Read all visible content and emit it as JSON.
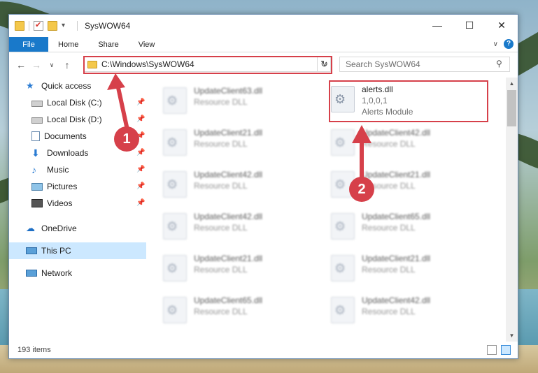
{
  "window": {
    "title": "SysWOW64"
  },
  "window_controls": {
    "minimize": "—",
    "maximize": "☐",
    "close": "✕"
  },
  "ribbon": {
    "tabs": [
      "File",
      "Home",
      "Share",
      "View"
    ],
    "help": "?"
  },
  "address": {
    "path": "C:\\Windows\\SysWOW64"
  },
  "search": {
    "placeholder": "Search SysWOW64"
  },
  "sidebar": {
    "quick_access": "Quick access",
    "items": [
      {
        "label": "Local Disk (C:)",
        "icon": "drive-icon",
        "pinned": true
      },
      {
        "label": "Local Disk (D:)",
        "icon": "drive-icon",
        "pinned": true
      },
      {
        "label": "Documents",
        "icon": "documents-icon",
        "pinned": true
      },
      {
        "label": "Downloads",
        "icon": "downloads-icon",
        "pinned": true
      },
      {
        "label": "Music",
        "icon": "music-icon",
        "pinned": true
      },
      {
        "label": "Pictures",
        "icon": "pictures-icon",
        "pinned": true
      },
      {
        "label": "Videos",
        "icon": "videos-icon",
        "pinned": true
      }
    ],
    "onedrive": "OneDrive",
    "this_pc": "This PC",
    "network": "Network"
  },
  "files": {
    "highlighted": {
      "name": "alerts.dll",
      "version": "1,0,0,1",
      "description": "Alerts Module"
    },
    "left_column": [
      {
        "name": "UpdateClient63.dll",
        "type": "Resource DLL"
      },
      {
        "name": "UpdateClient21.dll",
        "type": "Resource DLL"
      },
      {
        "name": "UpdateClient42.dll",
        "type": "Resource DLL"
      },
      {
        "name": "UpdateClient42.dll",
        "type": "Resource DLL"
      },
      {
        "name": "UpdateClient21.dll",
        "type": "Resource DLL"
      },
      {
        "name": "UpdateClient65.dll",
        "type": "Resource DLL"
      }
    ],
    "right_column": [
      {
        "name": "UpdateClient42.dll",
        "type": "Resource DLL"
      },
      {
        "name": "UpdateClient21.dll",
        "type": "Resource DLL"
      },
      {
        "name": "UpdateClient65.dll",
        "type": "Resource DLL"
      },
      {
        "name": "UpdateClient21.dll",
        "type": "Resource DLL"
      },
      {
        "name": "UpdateClient42.dll",
        "type": "Resource DLL"
      }
    ]
  },
  "status": {
    "item_count": "193 items"
  },
  "annotations": {
    "step1": "1",
    "step2": "2",
    "color": "#d6404a"
  }
}
